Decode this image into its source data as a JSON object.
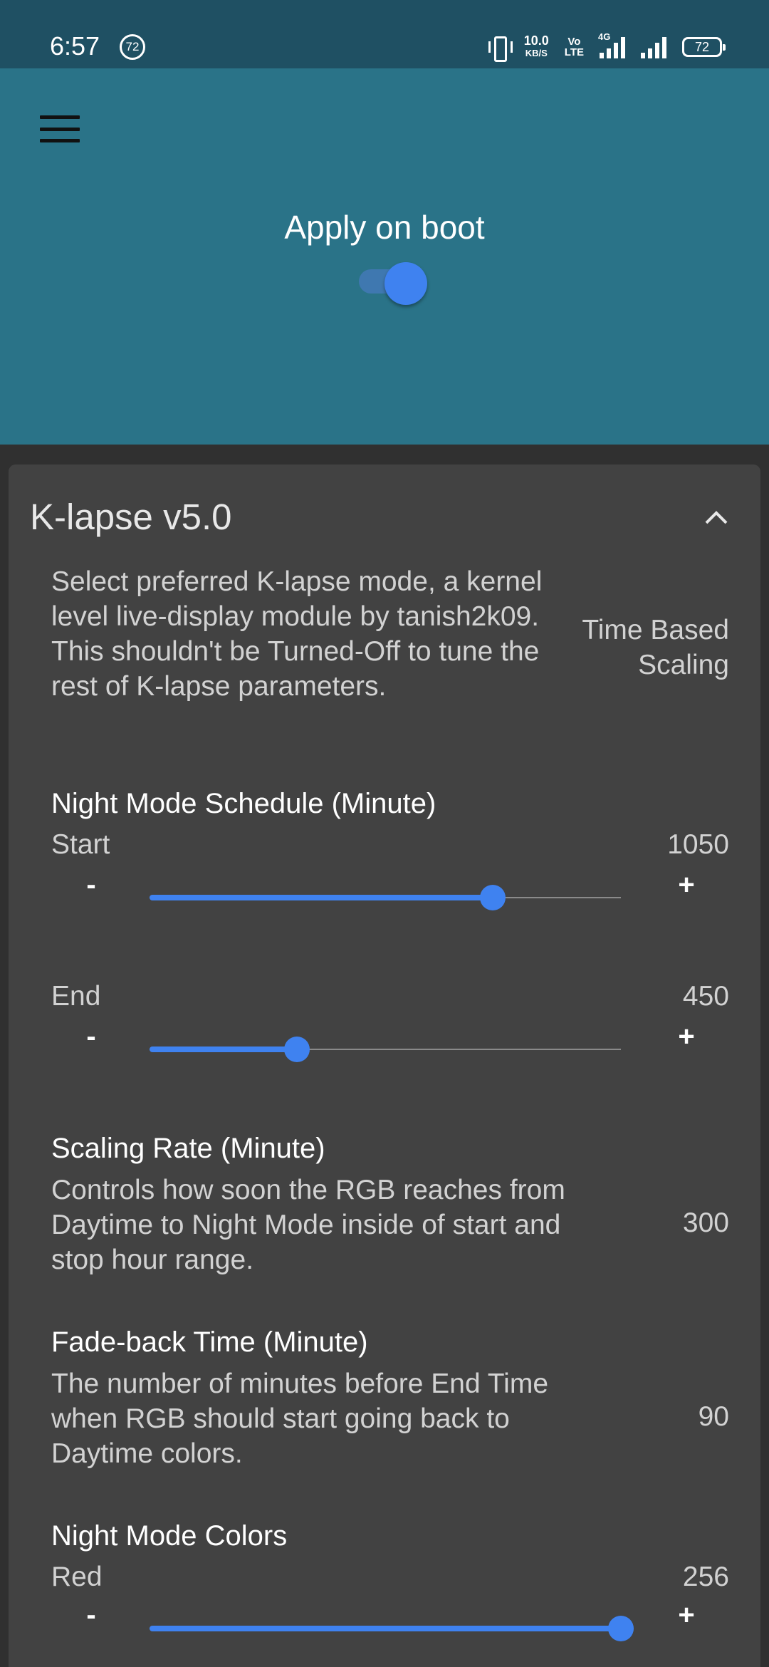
{
  "status_bar": {
    "time": "6:57",
    "notification_badge": "72",
    "net_speed_value": "10.0",
    "net_speed_unit": "KB/S",
    "volte_top": "Vo",
    "volte_bottom": "LTE",
    "network_type": "4G",
    "battery": "72"
  },
  "header": {
    "menu_icon": "hamburger-menu-icon",
    "apply_on_boot_label": "Apply on boot",
    "apply_on_boot_enabled": true,
    "accent_color": "#3f82f0"
  },
  "card": {
    "title": "K-lapse v5.0",
    "description": "Select preferred K-lapse mode, a kernel level live-display module by tanish2k09. This shouldn't be Turned-Off to tune the rest of K-lapse parameters.",
    "mode_value": "Time Based Scaling",
    "night_schedule": {
      "title": "Night Mode Schedule (Minute)",
      "start": {
        "label": "Start",
        "value": "1050",
        "fraction": 0.728
      },
      "end": {
        "label": "End",
        "value": "450",
        "fraction": 0.312
      }
    },
    "scaling_rate": {
      "title": "Scaling Rate (Minute)",
      "description": "Controls how soon the RGB reaches from Daytime to Night Mode inside of start and stop hour range.",
      "value": "300"
    },
    "fade_back": {
      "title": "Fade-back Time (Minute)",
      "description": "The number of minutes before End Time when RGB should start going back to Daytime colors.",
      "value": "90"
    },
    "night_colors": {
      "title": "Night Mode Colors",
      "red": {
        "label": "Red",
        "value": "256",
        "fraction": 1.0
      }
    },
    "minus_label": "-",
    "plus_label": "+"
  }
}
